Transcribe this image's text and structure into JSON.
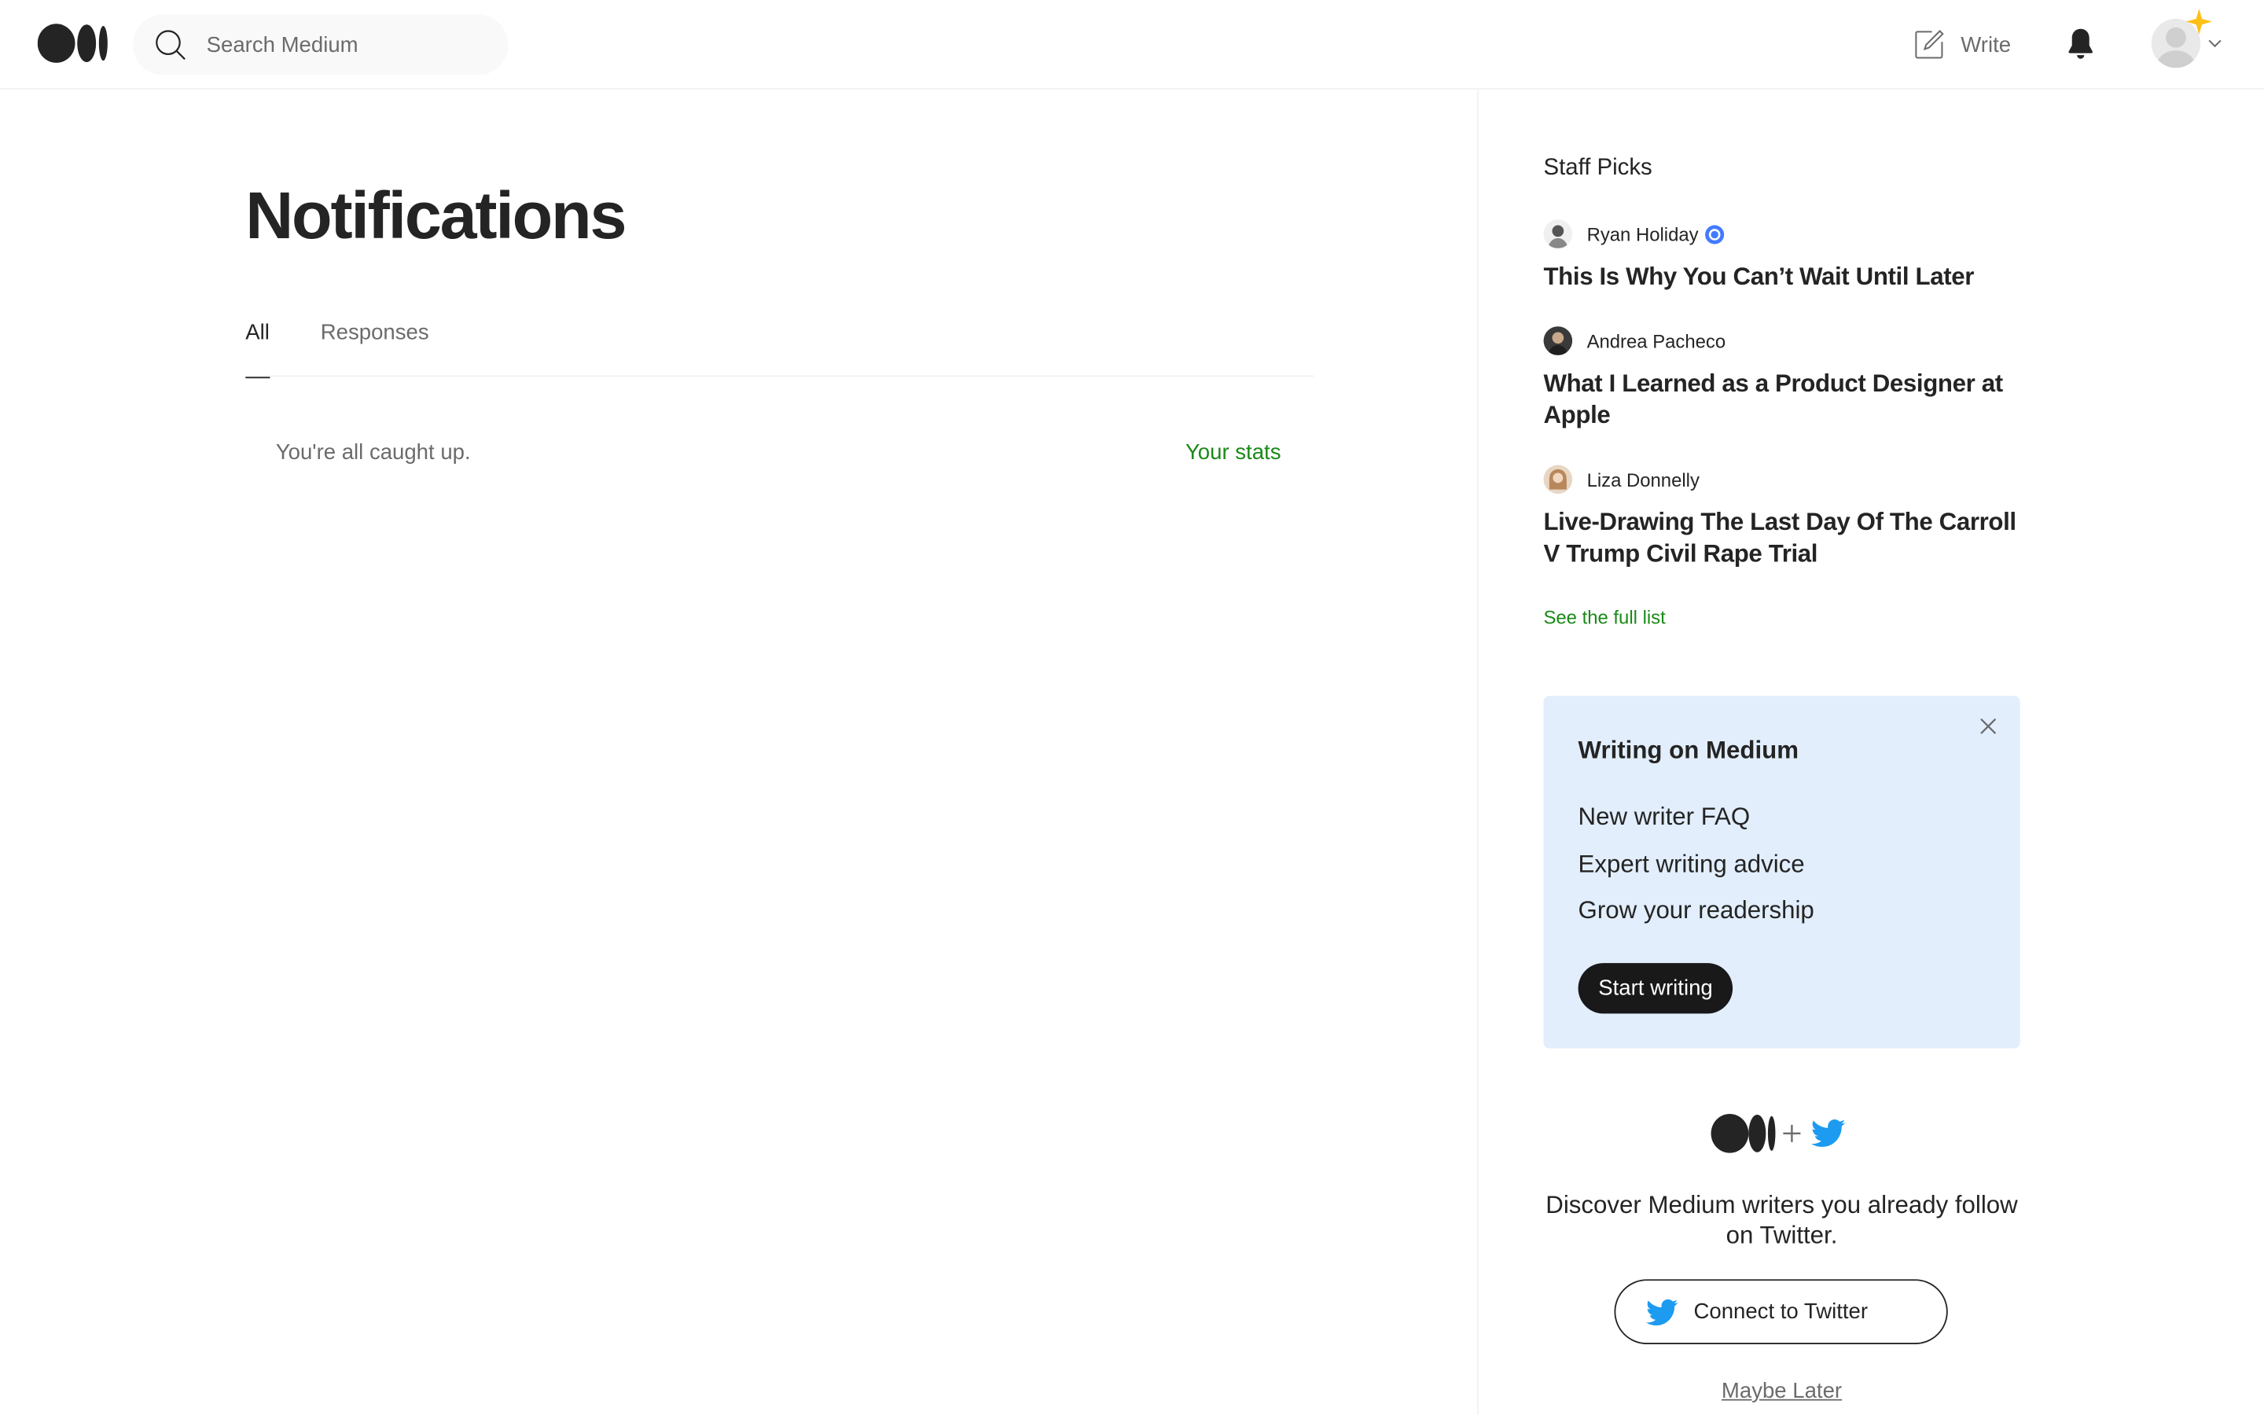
{
  "header": {
    "search_placeholder": "Search Medium",
    "write_label": "Write"
  },
  "main": {
    "title": "Notifications",
    "tabs": [
      {
        "label": "All",
        "active": true
      },
      {
        "label": "Responses",
        "active": false
      }
    ],
    "empty_message": "You're all caught up.",
    "stats_link": "Your stats"
  },
  "sidebar": {
    "heading": "Staff Picks",
    "picks": [
      {
        "author": "Ryan Holiday",
        "verified": true,
        "title": "This Is Why You Can’t Wait Until Later"
      },
      {
        "author": "Andrea Pacheco",
        "verified": false,
        "title": "What I Learned as a Product Designer at Apple"
      },
      {
        "author": "Liza Donnelly",
        "verified": false,
        "title": "Live-Drawing The Last Day Of The Carroll V Trump Civil Rape Trial"
      }
    ],
    "see_full_list": "See the full list",
    "writing_card": {
      "title": "Writing on Medium",
      "links": [
        "New writer FAQ",
        "Expert writing advice",
        "Grow your readership"
      ],
      "button": "Start writing"
    },
    "twitter": {
      "text": "Discover Medium writers you already follow on Twitter.",
      "button": "Connect to Twitter",
      "dismiss": "Maybe Later"
    }
  },
  "colors": {
    "accent_green": "#1a8917",
    "card_bg": "#e2eefc",
    "twitter_blue": "#1d9bf0",
    "text_primary": "#242424",
    "text_secondary": "#6b6b6b"
  }
}
